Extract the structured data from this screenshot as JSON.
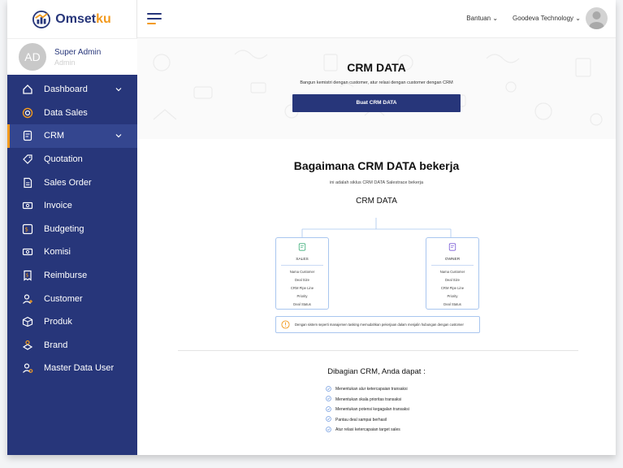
{
  "brand": {
    "name_main": "Omset",
    "name_accent": "ku"
  },
  "user": {
    "initials": "AD",
    "name": "Super Admin",
    "role": "Admin"
  },
  "sidebar": {
    "items": [
      {
        "label": "Dashboard",
        "icon": "home-icon",
        "has_chevron": true
      },
      {
        "label": "Data Sales",
        "icon": "target-icon",
        "has_chevron": false
      },
      {
        "label": "CRM",
        "icon": "document-icon",
        "has_chevron": true,
        "active": true
      },
      {
        "label": "Quotation",
        "icon": "tag-icon",
        "has_chevron": false
      },
      {
        "label": "Sales Order",
        "icon": "file-icon",
        "has_chevron": false
      },
      {
        "label": "Invoice",
        "icon": "money-icon",
        "has_chevron": false
      },
      {
        "label": "Budgeting",
        "icon": "budget-icon",
        "has_chevron": false
      },
      {
        "label": "Komisi",
        "icon": "money-icon",
        "has_chevron": false
      },
      {
        "label": "Reimburse",
        "icon": "receipt-icon",
        "has_chevron": false
      },
      {
        "label": "Customer",
        "icon": "user-plus-icon",
        "has_chevron": false
      },
      {
        "label": "Produk",
        "icon": "box-icon",
        "has_chevron": false
      },
      {
        "label": "Brand",
        "icon": "brand-icon",
        "has_chevron": false
      },
      {
        "label": "Master Data User",
        "icon": "user-settings-icon",
        "has_chevron": false
      }
    ]
  },
  "topbar": {
    "help_label": "Bantuan",
    "company_label": "Goodeva Technology"
  },
  "hero": {
    "title": "CRM DATA",
    "subtitle": "Bangun kemistri dengan customer, atur relasi dengan customer dengan CRM",
    "button_label": "Buat CRM DATA"
  },
  "how": {
    "title": "Bagaimana CRM DATA bekerja",
    "subtitle": "ini adalah siklus CRM DATA Salestrace bekerja",
    "root_label": "CRM DATA"
  },
  "cards": [
    {
      "title": "SALES",
      "fields": [
        "Nama Customer",
        "Deal Size",
        "CRM Pipe Line",
        "Priority",
        "Deal Status"
      ]
    },
    {
      "title": "OWNER",
      "fields": [
        "Nama Customer",
        "Deal Size",
        "CRM Pipe Line",
        "Priority",
        "Deal Status"
      ]
    }
  ],
  "note": {
    "text": "Dengan sistem seperti manajemen tasking memudahkan pekerjaan dalam menjalin hubungan dengan customer"
  },
  "benefits": {
    "title": "Dibagian CRM, Anda dapat :",
    "items": [
      "Menentukan alur ketercapaian transaksi",
      "Menentukan skala prioritas transaksi",
      "Menentukan potensi kegagalan transaksi",
      "Pantau deal sampai berhasil",
      "Atur relasi ketercapaian target sales"
    ]
  },
  "colors": {
    "primary": "#27367a",
    "accent": "#f29a1e",
    "card_border": "#a9c6ef",
    "check": "#5f8fdc"
  }
}
